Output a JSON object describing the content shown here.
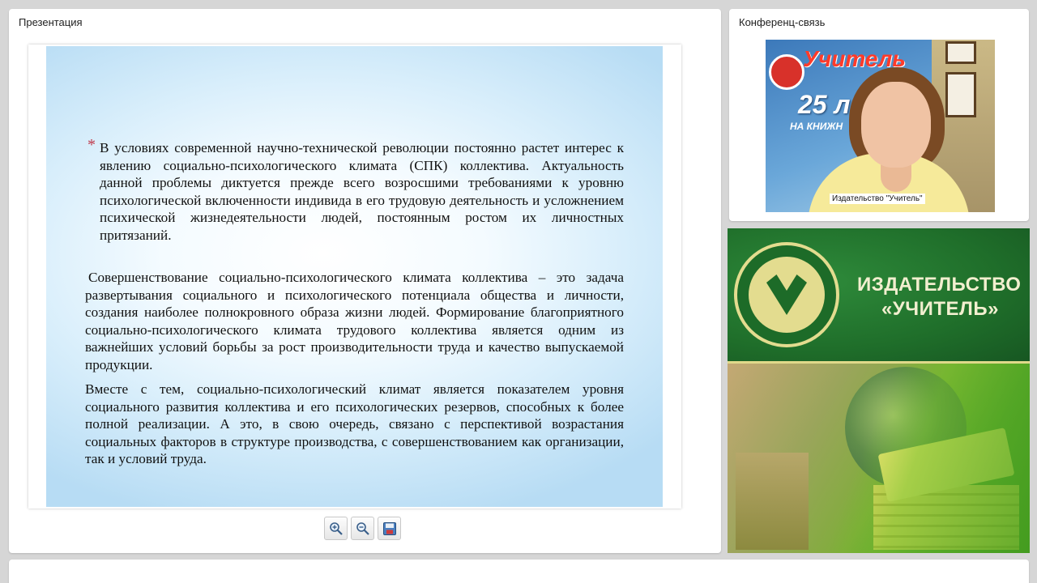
{
  "presentation": {
    "title": "Презентация",
    "slide": {
      "bullet": "*",
      "paragraph1": "В условиях современной научно-технической революции постоянно растет интерес к явлению социально-психологического климата (СПК) коллектива. Актуальность данной проблемы диктуется прежде всего возросшими требованиями к уровню психологической включенности индивида в его трудовую деятельность и усложнением психической жизнедеятельности людей, постоянным ростом их личностных притязаний.",
      "paragraph2": "Совершенствование социально-психологического климата коллектива – это задача развертывания социального и психологического потенциала общества и личности, создания наиболее полнокровного образа жизни людей. Формирование благоприятного социально-психологического климата трудового коллектива является одним из важнейших условий борьбы за рост производительности труда и качество выпускаемой продукции.",
      "paragraph3": "Вместе с тем, социально-психологический климат является показателем уровня социального развития коллектива и его психологических резервов, способных к более полной реализации. А это, в свою очередь, связано с перспективой возрастания социальных факторов в структуре производства, с совершенствованием как организации, так и условий труда."
    },
    "toolbar": {
      "zoom_in_icon": "zoom-in-icon",
      "zoom_out_icon": "zoom-out-icon",
      "save_icon": "save-icon"
    }
  },
  "conference": {
    "title": "Конференц-связь",
    "participant_label": "Издательство \"Учитель\"",
    "banner_text": "Учитель",
    "banner_number": "25 л",
    "banner_sub": "НА КНИЖН"
  },
  "brand": {
    "line1": "ИЗДАТЕЛЬСТВО",
    "line2": "«УЧИТЕЛЬ»",
    "colors": {
      "green": "#1f6e2a",
      "gold": "#e3dc8f"
    }
  }
}
